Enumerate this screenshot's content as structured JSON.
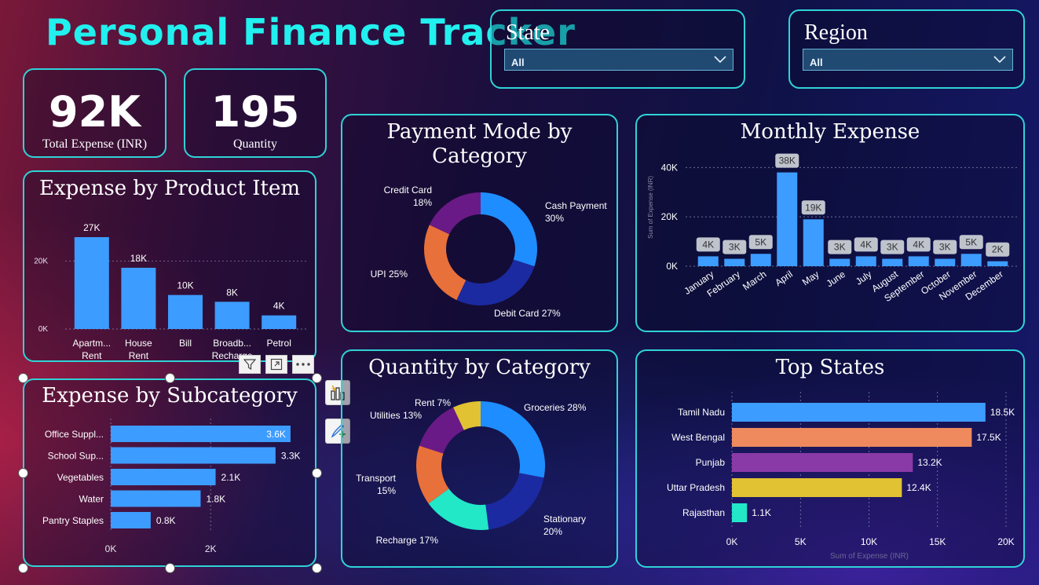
{
  "title": "Personal Finance Tracker",
  "kpis": {
    "total_expense_value": "92K",
    "total_expense_label": "Total Expense (INR)",
    "quantity_value": "195",
    "quantity_label": "Quantity"
  },
  "slicers": {
    "state": {
      "label": "State",
      "selected": "All"
    },
    "region": {
      "label": "Region",
      "selected": "All"
    }
  },
  "colors": {
    "accent": "#2fd3d6",
    "title": "#21f0ef",
    "bar": "#3d9cff"
  },
  "icons": [
    "filter-icon",
    "focus-mode-icon",
    "more-options-icon",
    "build-visual-icon",
    "format-visual-icon",
    "chevron-down-icon"
  ],
  "chart_data": [
    {
      "id": "product",
      "type": "bar",
      "title": "Expense by Product Item",
      "categories": [
        "Apartm... Rent",
        "House Rent",
        "Bill",
        "Broadb... Recharge",
        "Petrol"
      ],
      "values": [
        27000,
        18000,
        10000,
        8000,
        4000
      ],
      "data_labels": [
        "27K",
        "18K",
        "10K",
        "8K",
        "4K"
      ],
      "yticks": [
        "0K",
        "20K"
      ],
      "ylim": [
        0,
        30000
      ]
    },
    {
      "id": "payment",
      "type": "pie",
      "title": "Payment Mode by Category",
      "labels": [
        "Cash Payment",
        "Debit Card",
        "UPI",
        "Credit Card"
      ],
      "values": [
        30,
        27,
        25,
        18
      ],
      "label_text": [
        "Cash Payment|30%",
        "Debit Card 27%",
        "UPI 25%",
        "Credit Card|18%"
      ],
      "colors": [
        "#1e8dff",
        "#1b2aa0",
        "#e8703a",
        "#6a1a86"
      ]
    },
    {
      "id": "monthly",
      "type": "bar",
      "title": "Monthly Expense",
      "categories": [
        "January",
        "February",
        "March",
        "April",
        "May",
        "June",
        "July",
        "August",
        "September",
        "October",
        "November",
        "December"
      ],
      "values": [
        4000,
        3000,
        5000,
        38000,
        19000,
        3000,
        4000,
        3000,
        4000,
        3000,
        5000,
        2000
      ],
      "data_labels": [
        "4K",
        "3K",
        "5K",
        "38K",
        "19K",
        "3K",
        "4K",
        "3K",
        "4K",
        "3K",
        "5K",
        "2K"
      ],
      "yticks": [
        "0K",
        "20K",
        "40K"
      ],
      "ylim": [
        0,
        42000
      ],
      "ylabel": "Sum of Expense (INR)"
    },
    {
      "id": "subcategory",
      "type": "bar",
      "orientation": "horizontal",
      "title": "Expense by Subcategory",
      "categories": [
        "Office Suppl...",
        "School Sup...",
        "Vegetables",
        "Water",
        "Pantry Staples"
      ],
      "values": [
        3600,
        3300,
        2100,
        1800,
        800
      ],
      "data_labels": [
        "3.6K",
        "3.3K",
        "2.1K",
        "1.8K",
        "0.8K"
      ],
      "xticks": [
        "0K",
        "2K"
      ],
      "xlim": [
        0,
        3900
      ]
    },
    {
      "id": "quantity",
      "type": "pie",
      "title": "Quantity by Category",
      "labels": [
        "Groceries",
        "Stationary",
        "Recharge",
        "Transport",
        "Utilities",
        "Rent"
      ],
      "values": [
        28,
        20,
        17,
        15,
        13,
        7
      ],
      "label_text": [
        "Groceries 28%",
        "Stationary|20%",
        "Recharge 17%",
        "Transport|15%",
        "Utilities 13%",
        "Rent 7%"
      ],
      "colors": [
        "#1e8dff",
        "#1b2aa0",
        "#22e8c8",
        "#e8703a",
        "#6a1a86",
        "#e0c232"
      ]
    },
    {
      "id": "states",
      "type": "bar",
      "orientation": "horizontal",
      "title": "Top States",
      "categories": [
        "Tamil Nadu",
        "West Bengal",
        "Punjab",
        "Uttar Pradesh",
        "Rajasthan"
      ],
      "values": [
        18500,
        17500,
        13200,
        12400,
        1100
      ],
      "data_labels": [
        "18.5K",
        "17.5K",
        "13.2K",
        "12.4K",
        "1.1K"
      ],
      "colors": [
        "#3d9cff",
        "#ee8a5e",
        "#8a3aa6",
        "#e0c232",
        "#22e8c8"
      ],
      "xticks": [
        "0K",
        "5K",
        "10K",
        "15K",
        "20K"
      ],
      "xlim": [
        0,
        20000
      ],
      "xlabel": "Sum of Expense (INR)"
    }
  ]
}
